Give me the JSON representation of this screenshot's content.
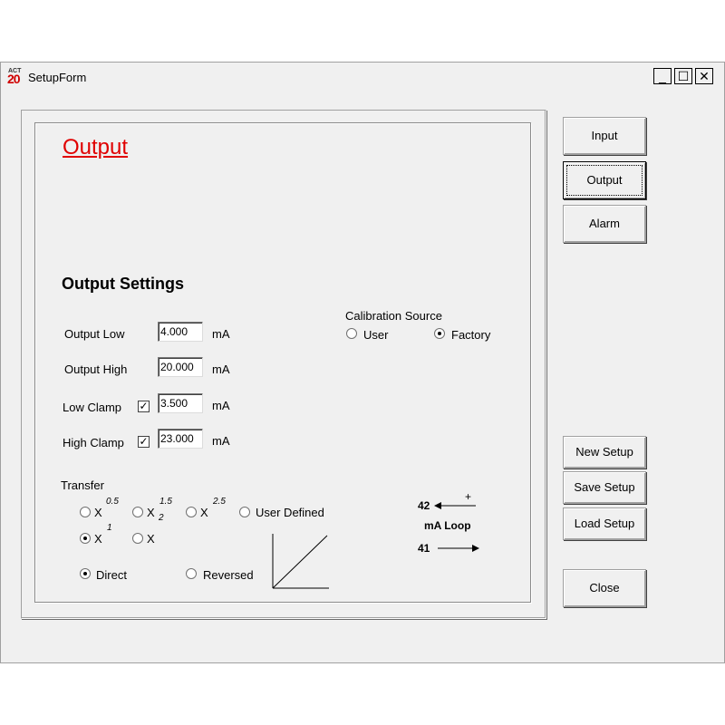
{
  "window": {
    "title": "SetupForm",
    "icon_text_top": "ACT",
    "icon_text_bottom": "20",
    "controls": {
      "minimize": "_",
      "maximize": "☐",
      "close": "✕"
    }
  },
  "page_heading": "Output",
  "section_title": "Output Settings",
  "fields": {
    "output_low": {
      "label": "Output Low",
      "value": "4.000",
      "unit": "mA"
    },
    "output_high": {
      "label": "Output High",
      "value": "20.000",
      "unit": "mA"
    },
    "low_clamp": {
      "label": "Low Clamp",
      "checked": true,
      "value": "3.500",
      "unit": "mA"
    },
    "high_clamp": {
      "label": "High Clamp",
      "checked": true,
      "value": "23.000",
      "unit": "mA"
    }
  },
  "calibration": {
    "label": "Calibration Source",
    "options": [
      "User",
      "Factory"
    ],
    "selected": "Factory"
  },
  "transfer": {
    "label": "Transfer",
    "options": {
      "x05": {
        "base": "X",
        "exp": "0.5"
      },
      "x152": {
        "base": "X",
        "exp": "1.5",
        "sub": "2"
      },
      "x25": {
        "base": "X",
        "exp": "2.5"
      },
      "user_defined": "User Defined",
      "x1": {
        "base": "X",
        "exp": "1"
      },
      "x": {
        "base": "X"
      }
    },
    "selected": "x1"
  },
  "direction": {
    "options": [
      "Direct",
      "Reversed"
    ],
    "selected": "Direct"
  },
  "loop": {
    "top_terminal": "42",
    "plus": "+",
    "label": "mA Loop",
    "bottom_terminal": "41"
  },
  "buttons": {
    "input": "Input",
    "output": "Output",
    "alarm": "Alarm",
    "new_setup": "New Setup",
    "save_setup": "Save Setup",
    "load_setup": "Load Setup",
    "close": "Close"
  },
  "colors": {
    "heading": "#e00000",
    "window_bg": "#f0f0f0"
  }
}
